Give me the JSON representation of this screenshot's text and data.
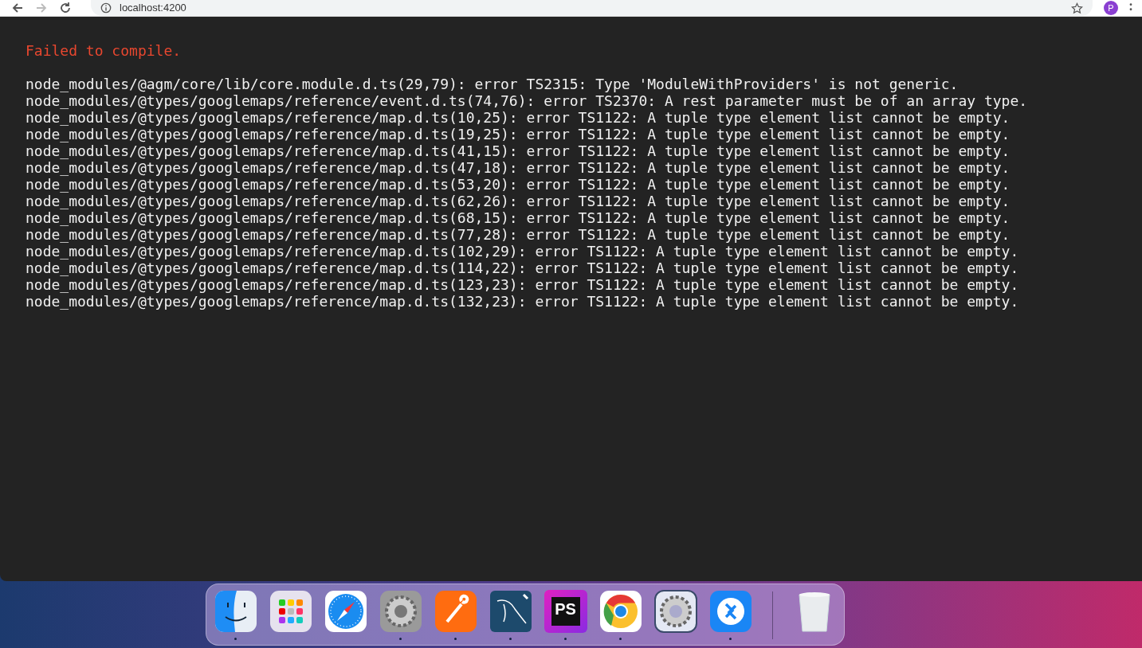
{
  "browser": {
    "url": "localhost:4200",
    "profile_initial": "P"
  },
  "overlay": {
    "title": "Failed to compile.",
    "errors": [
      "node_modules/@agm/core/lib/core.module.d.ts(29,79): error TS2315: Type 'ModuleWithProviders' is not generic.",
      "node_modules/@types/googlemaps/reference/event.d.ts(74,76): error TS2370: A rest parameter must be of an array type.",
      "node_modules/@types/googlemaps/reference/map.d.ts(10,25): error TS1122: A tuple type element list cannot be empty.",
      "node_modules/@types/googlemaps/reference/map.d.ts(19,25): error TS1122: A tuple type element list cannot be empty.",
      "node_modules/@types/googlemaps/reference/map.d.ts(41,15): error TS1122: A tuple type element list cannot be empty.",
      "node_modules/@types/googlemaps/reference/map.d.ts(47,18): error TS1122: A tuple type element list cannot be empty.",
      "node_modules/@types/googlemaps/reference/map.d.ts(53,20): error TS1122: A tuple type element list cannot be empty.",
      "node_modules/@types/googlemaps/reference/map.d.ts(62,26): error TS1122: A tuple type element list cannot be empty.",
      "node_modules/@types/googlemaps/reference/map.d.ts(68,15): error TS1122: A tuple type element list cannot be empty.",
      "node_modules/@types/googlemaps/reference/map.d.ts(77,28): error TS1122: A tuple type element list cannot be empty.",
      "node_modules/@types/googlemaps/reference/map.d.ts(102,29): error TS1122: A tuple type element list cannot be empty.",
      "node_modules/@types/googlemaps/reference/map.d.ts(114,22): error TS1122: A tuple type element list cannot be empty.",
      "node_modules/@types/googlemaps/reference/map.d.ts(123,23): error TS1122: A tuple type element list cannot be empty.",
      "node_modules/@types/googlemaps/reference/map.d.ts(132,23): error TS1122: A tuple type element list cannot be empty."
    ]
  },
  "dock": {
    "items": [
      {
        "kind": "finder",
        "running": true
      },
      {
        "kind": "launchpad",
        "running": false
      },
      {
        "kind": "safari",
        "running": false
      },
      {
        "kind": "settings",
        "running": true
      },
      {
        "kind": "postman",
        "running": true
      },
      {
        "kind": "mysql",
        "running": true
      },
      {
        "kind": "phpstorm",
        "label": "PS",
        "running": true
      },
      {
        "kind": "chrome",
        "running": true
      },
      {
        "kind": "gear",
        "running": false
      },
      {
        "kind": "remote",
        "running": true
      },
      {
        "kind": "trash",
        "running": false
      }
    ]
  }
}
